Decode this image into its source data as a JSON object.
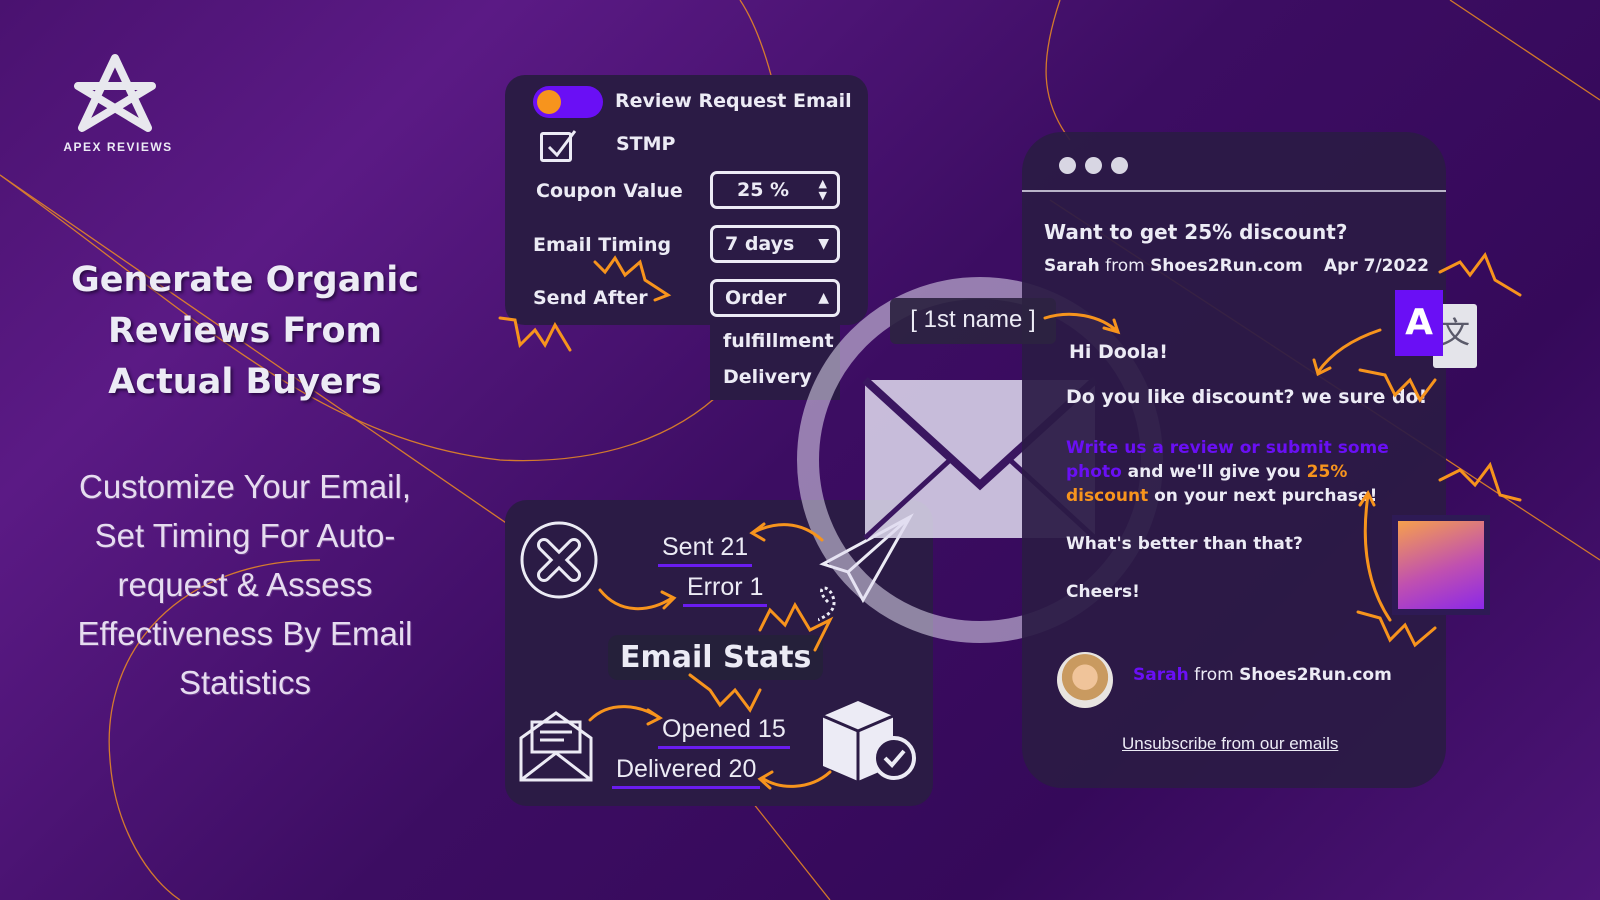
{
  "brand": {
    "name": "APEX REVIEWS",
    "accent": "#f7941d",
    "purple": "#6a0ff5"
  },
  "headline": [
    "Generate Organic",
    "Reviews From",
    "Actual Buyers"
  ],
  "subheadline": [
    "Customize Your Email,",
    "Set Timing For Auto-",
    "request & Assess",
    "Effectiveness By Email",
    "Statistics"
  ],
  "settings": {
    "toggle_label": "Review Request Email",
    "toggle_on": true,
    "checkbox_label": "STMP",
    "checkbox_checked": true,
    "coupon_label": "Coupon Value",
    "coupon_value": "25 %",
    "timing_label": "Email Timing",
    "timing_value": "7 days",
    "send_after_label": "Send After",
    "send_after_value": "Order",
    "send_after_options": [
      "fulfillment",
      "Delivery"
    ]
  },
  "placeholder_tag": "[ 1st name ]",
  "stats": {
    "title": "Email Stats",
    "sent": "Sent 21",
    "error": "Error 1",
    "opened": "Opened 15",
    "delivered": "Delivered 20"
  },
  "email": {
    "subject": "Want to get 25% discount?",
    "sender_name": "Sarah",
    "sender_from": "from",
    "sender_domain": "Shoes2Run.com",
    "date": "Apr 7/2022",
    "greeting": "Hi Doola!",
    "line1": "Do you like discount? we sure do!",
    "cta_link": "Write us a review or submit some photo",
    "cta_mid": " and we'll give you ",
    "cta_highlight": "25% discount",
    "cta_end": " on your next purchase!",
    "line3": "What's better than that?",
    "signoff": "Cheers!",
    "footer_name": "Sarah",
    "footer_from": "from",
    "footer_domain": "Shoes2Run.com",
    "unsubscribe": "Unsubscribe from our emails"
  },
  "translate_icon_letter": "A"
}
